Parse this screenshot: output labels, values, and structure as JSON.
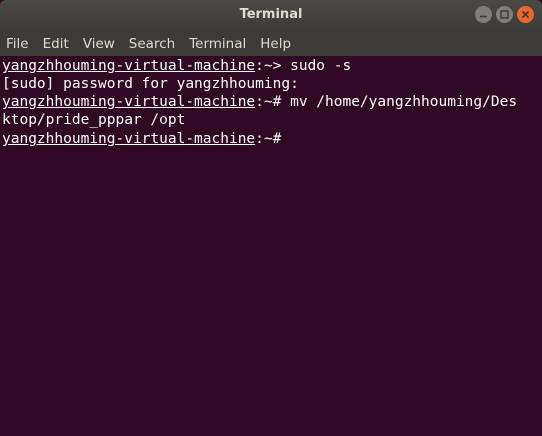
{
  "window": {
    "title": "Terminal"
  },
  "menubar": {
    "items": [
      "File",
      "Edit",
      "View",
      "Search",
      "Terminal",
      "Help"
    ]
  },
  "terminal": {
    "lines": [
      {
        "host": "yangzhhouming-virtual-machine",
        "rest": ":~> sudo -s"
      },
      {
        "host": "",
        "rest": "[sudo] password for yangzhhouming:"
      },
      {
        "host": "yangzhhouming-virtual-machine",
        "rest": ":~# mv /home/yangzhhouming/Des"
      },
      {
        "host": "",
        "rest": "ktop/pride_pppar /opt"
      },
      {
        "host": "yangzhhouming-virtual-machine",
        "rest": ":~#"
      }
    ]
  },
  "colors": {
    "terminal_bg": "#300a24",
    "titlebar_bg": "#3c3b37",
    "close_button": "#e9662f",
    "text": "#ffffff"
  },
  "icons": {
    "minimize": "minimize-icon",
    "maximize": "maximize-icon",
    "close": "close-icon"
  }
}
